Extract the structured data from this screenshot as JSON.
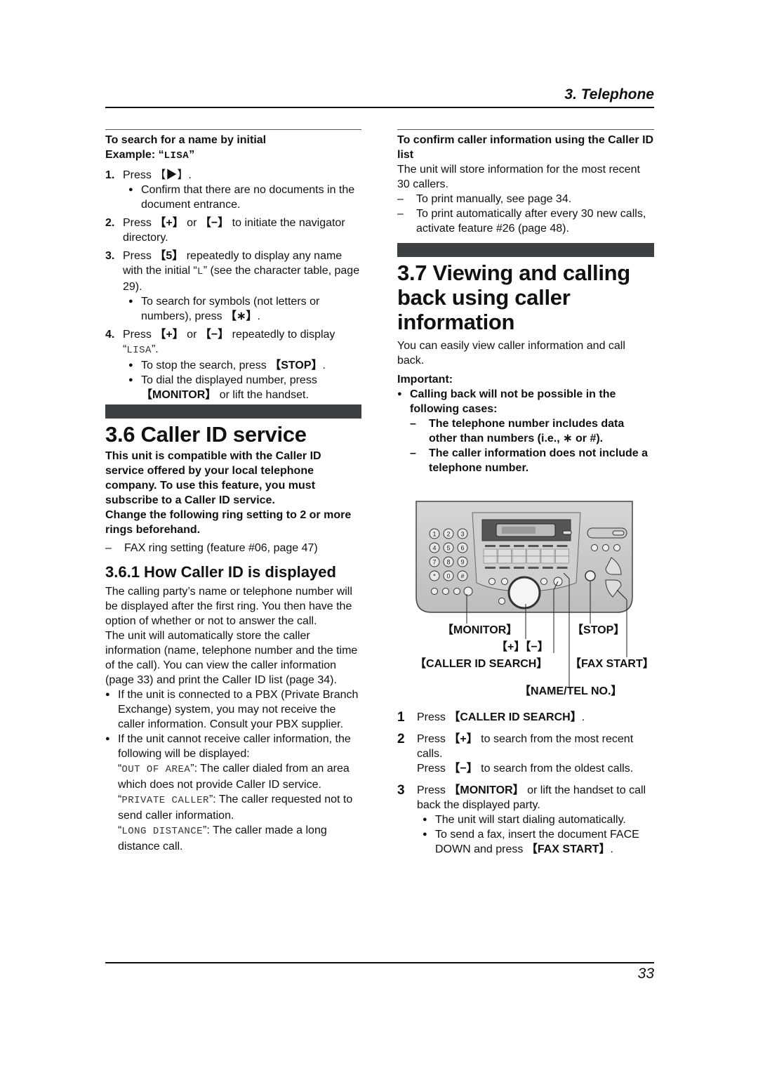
{
  "header": {
    "chapter": "3. Telephone"
  },
  "footer": {
    "page_number": "33"
  },
  "left_column": {
    "search_initial": {
      "heading": "To search for a name by initial",
      "example_prefix": "Example: “",
      "example_value": "LISA",
      "example_suffix": "”",
      "steps": [
        {
          "num": "1.",
          "pre": "Press ",
          "key": "▶",
          "post": ".",
          "bullets": [
            "Confirm that there are no documents in the document entrance."
          ]
        },
        {
          "num": "2.",
          "pre": "Press ",
          "key": "+",
          "mid": " or ",
          "key2": "−",
          "post": " to initiate the navigator directory."
        },
        {
          "num": "3.",
          "pre": "Press ",
          "key": "5",
          "post_a": " repeatedly to display any name with the initial “",
          "mono": "L",
          "post_b": "” (see the character table, page 29).",
          "bullet_pre": "To search for symbols (not letters or numbers), press ",
          "bullet_key": "∗",
          "bullet_post": "."
        },
        {
          "num": "4.",
          "pre": "Press ",
          "key": "+",
          "mid": " or ",
          "key2": "−",
          "post": " repeatedly to display",
          "mono_line_pre": "“",
          "mono": "LISA",
          "mono_line_post": "”.",
          "bullet1_pre": "To stop the search, press ",
          "bullet1_key": "STOP",
          "bullet1_post": ".",
          "bullet2_pre": "To dial the displayed number, press ",
          "bullet2_key": "MONITOR",
          "bullet2_post": " or lift the handset."
        }
      ]
    },
    "section_36": {
      "title": "3.6 Caller ID service",
      "intro_bold_1": "This unit is compatible with the Caller ID service offered by your local telephone company. To use this feature, you must subscribe to a Caller ID service.",
      "intro_bold_2": "Change the following ring setting to 2 or more rings beforehand.",
      "dash_item": "FAX ring setting (feature #06, page 47)"
    },
    "section_361": {
      "title": "3.6.1 How Caller ID is displayed",
      "para1": "The calling party’s name or telephone number will be displayed after the first ring. You then have the option of whether or not to answer the call.",
      "para2": "The unit will automatically store the caller information (name, telephone number and the time of the call). You can view the caller information (page 33) and print the Caller ID list (page 34).",
      "bullet1": "If the unit is connected to a PBX (Private Branch Exchange) system, you may not receive the caller information. Consult your PBX supplier.",
      "bullet2": "If the unit cannot receive caller information, the following will be displayed:",
      "messages": [
        {
          "code": "OUT OF AREA",
          "desc": ": The caller dialed from an area which does not provide Caller ID service."
        },
        {
          "code": "PRIVATE CALLER",
          "desc": ": The caller requested not to send caller information."
        },
        {
          "code": "LONG DISTANCE",
          "desc": ": The caller made a long distance call."
        }
      ]
    }
  },
  "right_column": {
    "confirm_list": {
      "heading": "To confirm caller information using the Caller ID list",
      "para": "The unit will store information for the most recent 30 callers.",
      "dashes": [
        "To print manually, see page 34.",
        "To print automatically after every 30 new calls, activate feature #26 (page 48)."
      ]
    },
    "section_37": {
      "title": "3.7 Viewing and calling back using caller information",
      "intro": "You can easily view caller information and call back.",
      "important_label": "Important:",
      "important_bullet": "Calling back will not be possible in the following cases:",
      "important_dash_1_pre": "The telephone number includes data other than numbers (i.e., ",
      "important_dash_1_star": "∗",
      "important_dash_1_post": " or #).",
      "important_dash_2": "The caller information does not include a telephone number."
    },
    "diagram_labels": {
      "monitor": "MONITOR",
      "stop": "STOP",
      "plus_minus": "+】【−",
      "caller_id_search": "CALLER ID SEARCH",
      "fax_start": "FAX START",
      "name_tel": "NAME/TEL NO.",
      "keypad": [
        "1",
        "2",
        "3",
        "4",
        "5",
        "6",
        "7",
        "8",
        "9",
        "*",
        "0",
        "#"
      ]
    },
    "steps": [
      {
        "num": "1",
        "pre": "Press ",
        "key": "CALLER ID SEARCH",
        "post": "."
      },
      {
        "num": "2",
        "pre": "Press ",
        "key": "+",
        "post": " to search from the most recent calls.",
        "line2_pre": "Press ",
        "line2_key": "−",
        "line2_post": " to search from the oldest calls."
      },
      {
        "num": "3",
        "pre": "Press ",
        "key": "MONITOR",
        "post": " or lift the handset to call back the displayed party.",
        "bullet1": "The unit will start dialing automatically.",
        "bullet2_pre": "To send a fax, insert the document FACE DOWN and press ",
        "bullet2_key": "FAX START",
        "bullet2_post": "."
      }
    ]
  }
}
